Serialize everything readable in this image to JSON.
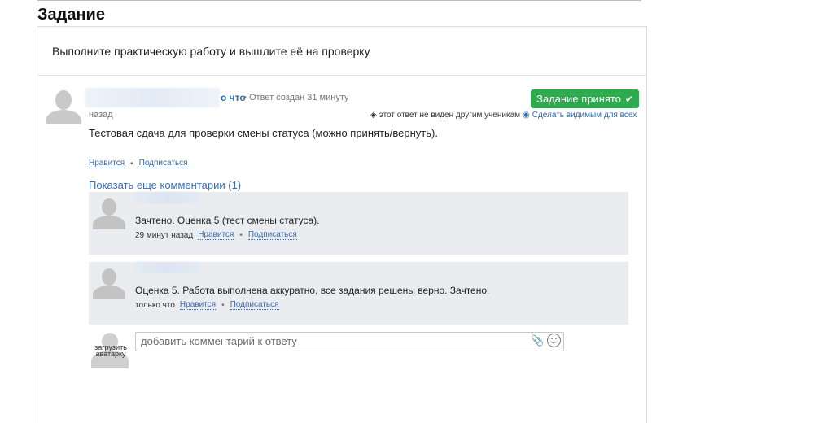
{
  "page": {
    "title": "Задание",
    "task_description": "Выполните практическую работу и вышлите её на проверку"
  },
  "answer": {
    "author_tail": "о что",
    "meta_separator": "•",
    "created_text": "Ответ создан 31 минуту",
    "created_ago": "назад",
    "status_button": "Задание принято",
    "status_icon": "check-icon",
    "privacy_note": "этот ответ не виден другим ученикам",
    "make_visible": "Сделать видимым для всех",
    "text": "Тестовая сдача для проверки смены статуса (можно принять/вернуть).",
    "like": "Нравится",
    "subscribe": "Подписаться",
    "action_separator": "•"
  },
  "comments_section": {
    "show_more": "Показать еще комментарии (1)",
    "items": [
      {
        "text": "Зачтено. Оценка 5 (тест смены статуса).",
        "ago": "29 минут назад",
        "like": "Нравится",
        "separator": "•",
        "subscribe": "Подписаться"
      },
      {
        "text": "Оценка 5. Работа выполнена аккуратно, все задания решены верно. Зачтено.",
        "ago": "только что",
        "like": "Нравится",
        "separator": "•",
        "subscribe": "Подписаться"
      }
    ]
  },
  "new_comment": {
    "upload_avatar": "загрузить аватарку",
    "placeholder": "добавить комментарий к ответу",
    "attach_icon": "paperclip-icon",
    "emoji_icon": "smiley-icon"
  },
  "colors": {
    "accent_link": "#3a6db5",
    "success": "#2eaa4f",
    "comment_bg": "#ebecef"
  }
}
